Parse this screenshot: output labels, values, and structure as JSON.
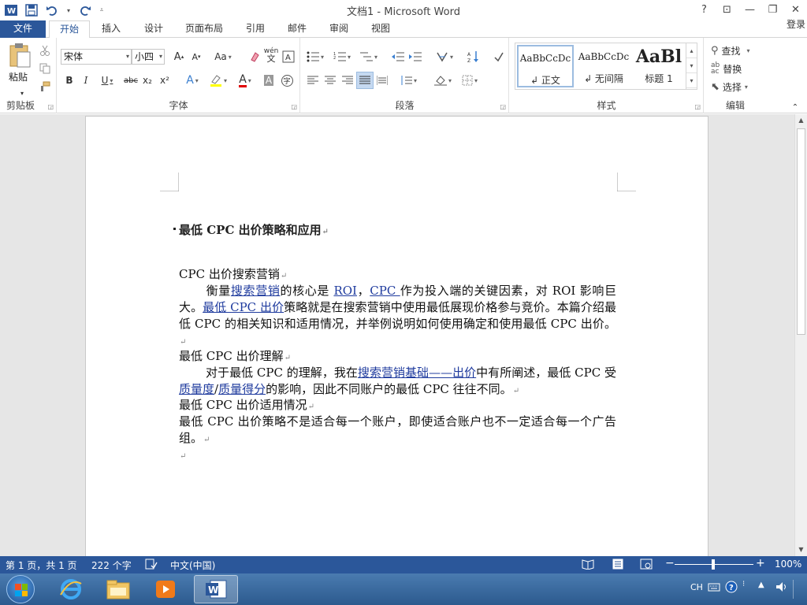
{
  "window": {
    "title": "文档1 - Microsoft Word",
    "controls": {
      "help": "?",
      "ribbon_display": "⊡",
      "minimize": "—",
      "restore": "❐",
      "close": "✕"
    }
  },
  "qat": {
    "word_icon": "W",
    "save_icon": "save-icon",
    "undo_icon": "undo-icon",
    "redo_icon": "redo-icon",
    "customize_icon": "customize-icon"
  },
  "tabs": [
    "文件",
    "开始",
    "插入",
    "设计",
    "页面布局",
    "引用",
    "邮件",
    "审阅",
    "视图"
  ],
  "active_tab": "开始",
  "login": "登录",
  "ribbon": {
    "clipboard": {
      "label": "剪贴板",
      "paste": "粘贴"
    },
    "font": {
      "label": "字体",
      "font_name": "宋体",
      "font_size": "小四",
      "grow": "A",
      "shrink": "A",
      "change_case": "Aa",
      "phonetic": "wén",
      "bold": "B",
      "italic": "I",
      "underline": "U",
      "strike": "abc",
      "subscript": "x₂",
      "superscript": "x²",
      "text_effect": "A",
      "font_color": "A",
      "char_shading": "A",
      "enclose": "字"
    },
    "paragraph": {
      "label": "段落"
    },
    "styles": {
      "label": "样式",
      "items": [
        {
          "sample": "AaBbCcDc",
          "name": "↲ 正文"
        },
        {
          "sample": "AaBbCcDc",
          "name": "↲ 无间隔"
        },
        {
          "sample": "AaBl",
          "name": "标题 1"
        }
      ]
    },
    "editing": {
      "label": "编辑",
      "find": "查找",
      "replace": "替换",
      "select": "选择"
    }
  },
  "document": {
    "title": "最低 CPC 出价策略和应用",
    "h1": "CPC 出价搜索营销",
    "p1": {
      "t1": "衡量",
      "l1": "搜索营销",
      "t2": "的核心是 ",
      "l2": "ROI",
      "t3": "，",
      "l3": "CPC ",
      "t4": "作为投入端的关键因素，对 ROI 影响巨大。",
      "l4": "最低 CPC 出价",
      "t5": "策略就是在搜索营销中使用最低展现价格参与竞价。本篇介绍最低 CPC 的相关知识和适用情况，并举例说明如何使用确定和使用最低 CPC 出价。"
    },
    "h2": "最低 CPC 出价理解",
    "p2": {
      "t1": "对于最低 CPC 的理解，我在",
      "l1": "搜索营销基础——出价",
      "t2": "中有所阐述，最低 CPC 受",
      "l2": "质量度",
      "t3": "/",
      "l3": "质量得分",
      "t4": "的影响，因此不同账户的最低 CPC 往往不同。"
    },
    "h3": "最低 CPC 出价适用情况",
    "p3": "最低 CPC 出价策略不是适合每一个账户，即使适合账户也不一定适合每一个广告组。",
    "pilcrow": "↵"
  },
  "status": {
    "page": "第 1 页，共 1 页",
    "words": "222 个字",
    "language": "中文(中国)",
    "zoom": "100%",
    "zoom_minus": "−",
    "zoom_plus": "+"
  },
  "taskbar": {
    "tray_lang": "CH"
  },
  "colors": {
    "accent": "#2b579a",
    "link": "#1f3b9e"
  }
}
